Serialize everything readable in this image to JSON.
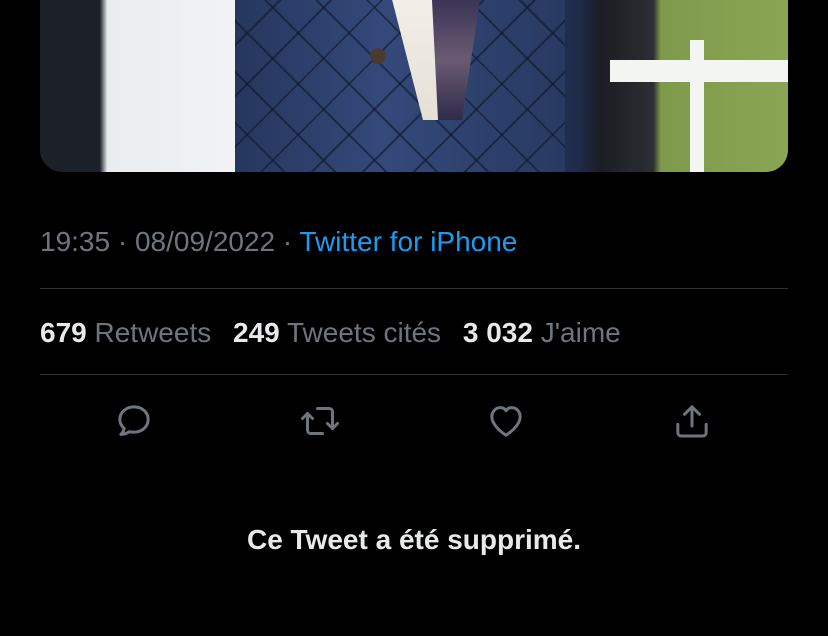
{
  "tweet": {
    "time": "19:35",
    "separator": "·",
    "date": "08/09/2022",
    "source": "Twitter for iPhone"
  },
  "stats": {
    "retweets_count": "679",
    "retweets_label": "Retweets",
    "quotes_count": "249",
    "quotes_label": "Tweets cités",
    "likes_count": "3 032",
    "likes_label": "J'aime"
  },
  "actions": {
    "icons": [
      "reply-icon",
      "retweet-icon",
      "like-icon",
      "share-icon"
    ],
    "icon_color": "#6e767d"
  },
  "notice": {
    "deleted_text": "Ce Tweet a été supprimé."
  },
  "colors": {
    "background": "#000000",
    "link": "#1d9bf0",
    "muted": "#6e767d",
    "text": "#e7e9ea",
    "divider": "#2f3336"
  }
}
